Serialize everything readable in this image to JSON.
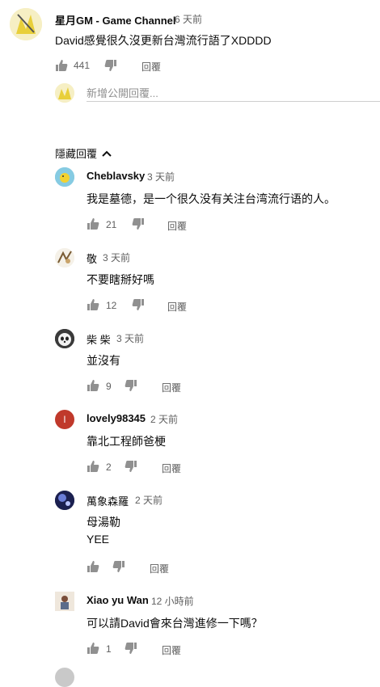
{
  "main_comment": {
    "author": "星月GM - Game Channel",
    "time": "6 天前",
    "text": "David感覺很久沒更新台灣流行語了XDDDD",
    "likes": "441",
    "reply_label": "回覆"
  },
  "reply_box": {
    "placeholder": "新增公開回覆..."
  },
  "hide_replies_label": "隱藏回覆",
  "replies": [
    {
      "author": "Cheblavsky",
      "time": "3 天前",
      "text": "我是墓德，是一个很久没有关注台湾流行语的人。",
      "likes": "21",
      "reply_label": "回覆"
    },
    {
      "author": "敬",
      "time": "3 天前",
      "text": "不要瞎掰好嗎",
      "likes": "12",
      "reply_label": "回覆"
    },
    {
      "author": "柴 柴",
      "time": "3 天前",
      "text": "並沒有",
      "likes": "9",
      "reply_label": "回覆"
    },
    {
      "author": "lovely98345",
      "time": "2 天前",
      "text": "靠北工程師爸梗",
      "likes": "2",
      "reply_label": "回覆"
    },
    {
      "author": "萬象森羅",
      "time": "2 天前",
      "text": "母湯勒",
      "text2": "YEE",
      "reply_label": "回覆"
    },
    {
      "author": "Xiao yu Wan",
      "time": "12 小時前",
      "text": "可以請David會來台灣進修一下嗎？",
      "likes": "1",
      "reply_label": "回覆"
    }
  ],
  "colors": {
    "text": "#0d0d0d",
    "meta": "#606060",
    "icon": "#909090"
  },
  "avatar_letter": "l"
}
